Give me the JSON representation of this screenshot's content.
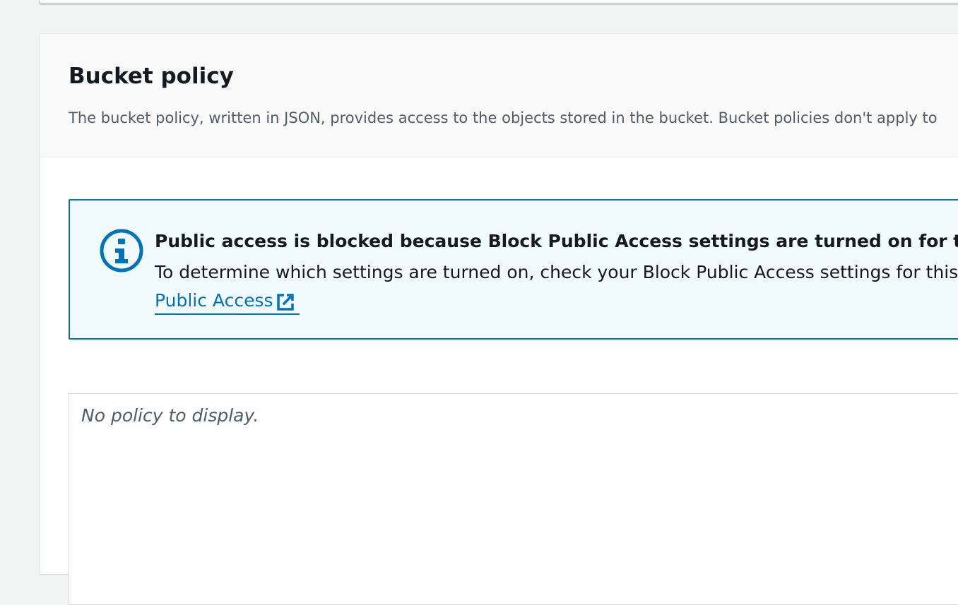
{
  "bucket_policy": {
    "title": "Bucket policy",
    "description": "The bucket policy, written in JSON, provides access to the objects stored in the bucket. Bucket policies don't apply to",
    "alert": {
      "type": "info",
      "icon": "info-icon",
      "title": "Public access is blocked because Block Public Access settings are turned on for this buc",
      "body": "To determine which settings are turned on, check your Block Public Access settings for this",
      "link_label": "Public Access",
      "link_icon": "external-link-icon"
    },
    "policy_editor": {
      "empty_text": "No policy to display."
    }
  },
  "colors": {
    "page_background": "#f2f3f3",
    "container_header_background": "#fafafa",
    "alert_background": "#f1faff",
    "alert_border": "#0073bb",
    "link": "#0073bb",
    "title_text": "#16191f",
    "secondary_text": "#545b64"
  }
}
